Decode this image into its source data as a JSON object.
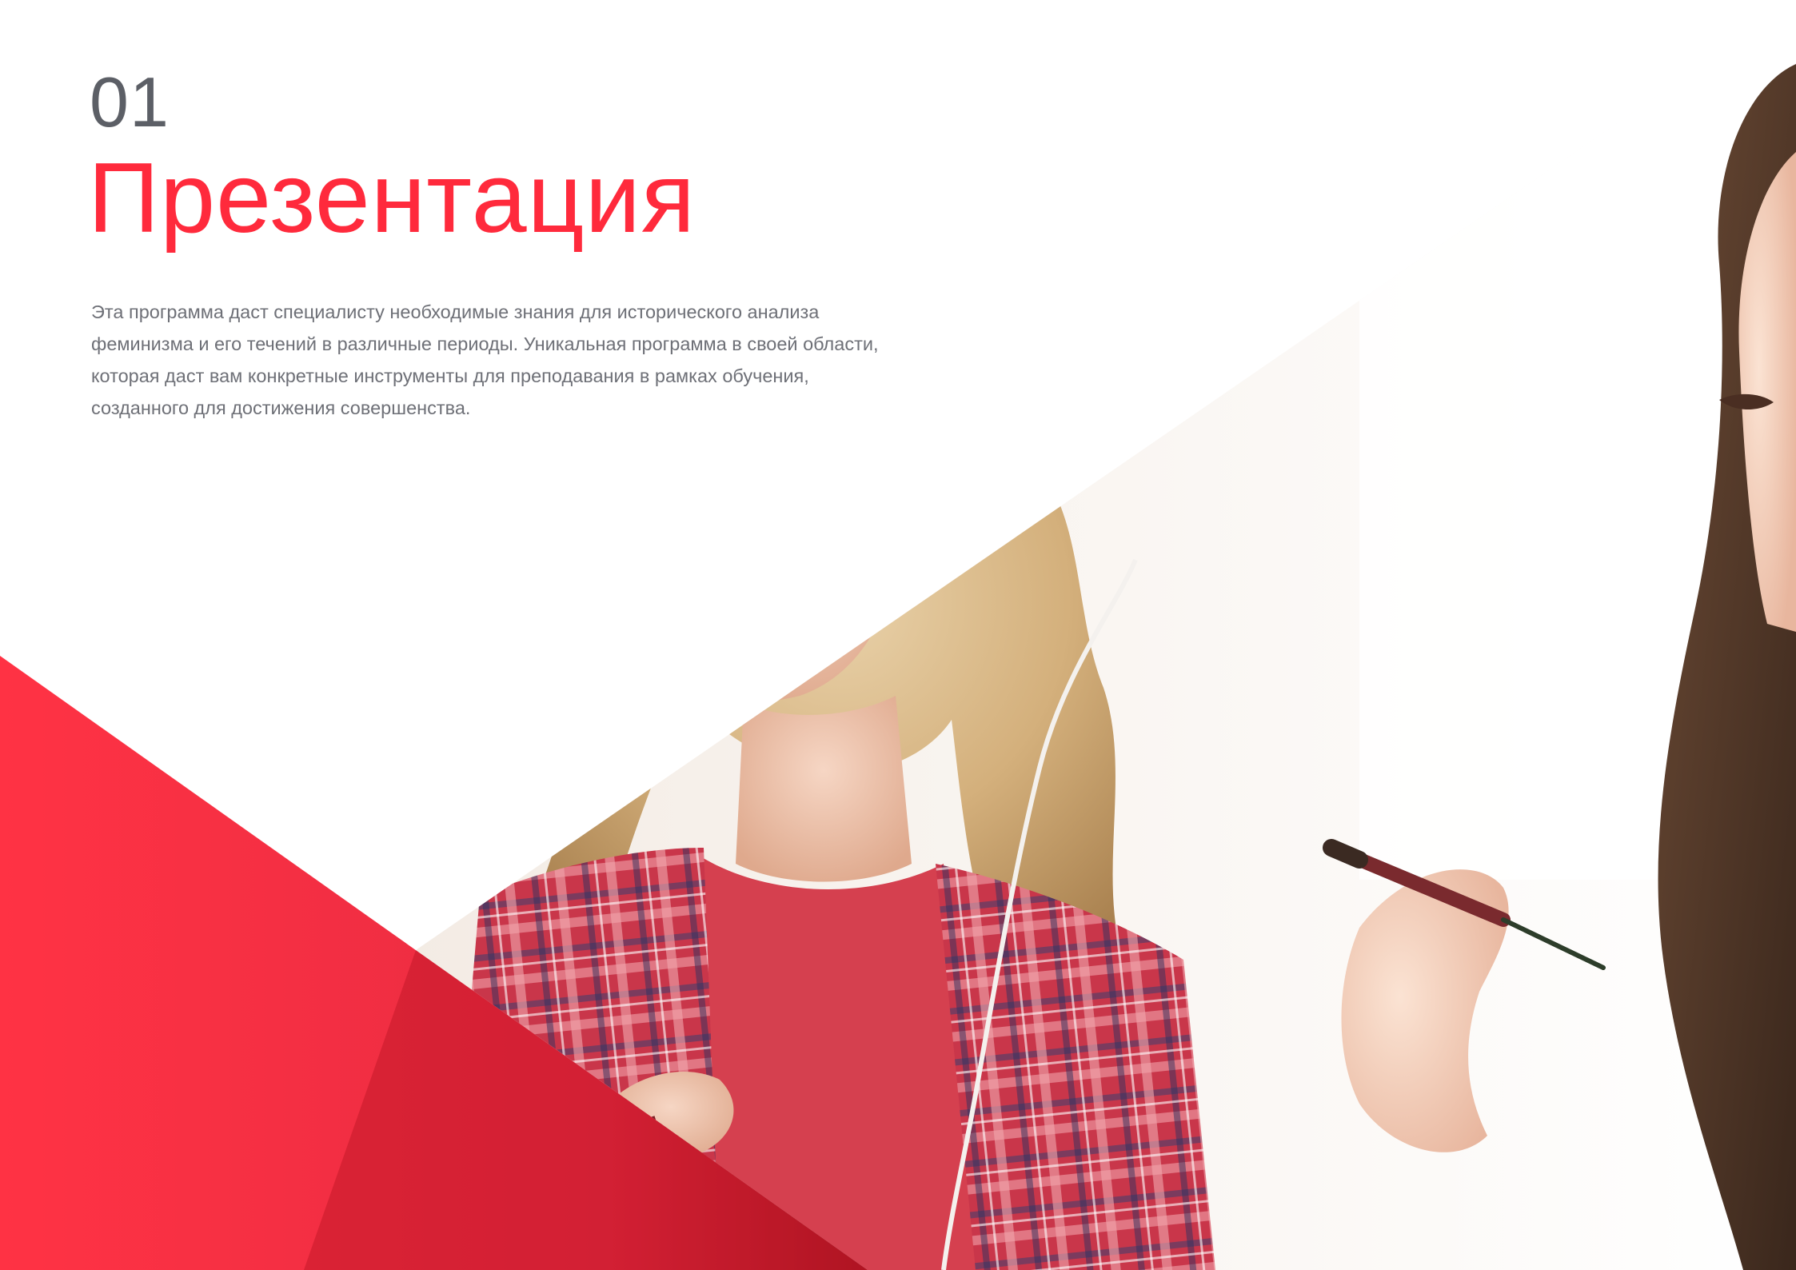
{
  "section": {
    "number": "01",
    "title": "Презентация",
    "intro": "Эта программа даст специалисту необходимые знания для исторического анализа феминизма и его течений в различные периоды. Уникальная программа в своей области, которая даст вам конкретные инструменты для преподавания в рамках обучения, созданного для достижения совершенства."
  },
  "colors": {
    "accent": "#ff2a3c",
    "number_text": "#5c5f66",
    "body_text": "#6e7077",
    "background": "#ffffff"
  },
  "icons": {
    "hero": "photo-two-women-painting-icon"
  }
}
